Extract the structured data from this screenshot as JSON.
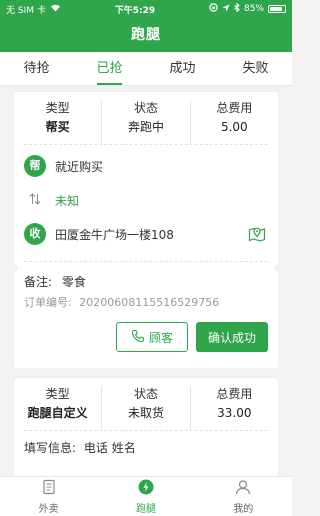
{
  "status_bar": {
    "carrier": "无 SIM 卡",
    "time": "下午5:29",
    "battery": "85%",
    "battery_level": 0.85
  },
  "header": {
    "title": "跑腿"
  },
  "tabs": [
    {
      "label": "待抢"
    },
    {
      "label": "已抢",
      "active": true
    },
    {
      "label": "成功"
    },
    {
      "label": "失败"
    }
  ],
  "orders": [
    {
      "stats": [
        {
          "label": "类型",
          "value": "帮买"
        },
        {
          "label": "状态",
          "value": "奔跑中"
        },
        {
          "label": "总费用",
          "value": "5.00"
        }
      ],
      "pickup": {
        "badge": "帮",
        "text": "就近购买"
      },
      "distance": "未知",
      "dropoff": {
        "badge": "收",
        "text": "田厦金牛广场一楼108"
      },
      "note_label": "备注:",
      "note_value": "零食",
      "order_no_label": "订单编号:",
      "order_no": "2020060811551652975​6",
      "contact_label": "顾客",
      "confirm_label": "确认成功"
    },
    {
      "stats": [
        {
          "label": "类型",
          "value": "跑腿自定义"
        },
        {
          "label": "状态",
          "value": "未取货"
        },
        {
          "label": "总费用",
          "value": "33.00"
        }
      ],
      "fill_info_label": "填写信息:",
      "fill_info_value": "电话 姓名"
    }
  ],
  "bottom_nav": [
    {
      "label": "外卖",
      "icon": "document-icon"
    },
    {
      "label": "跑腿",
      "icon": "lightning-icon",
      "active": true
    },
    {
      "label": "我的",
      "icon": "person-icon"
    }
  ],
  "colors": {
    "accent": "#2fa64b",
    "background": "#f2f2f2"
  }
}
